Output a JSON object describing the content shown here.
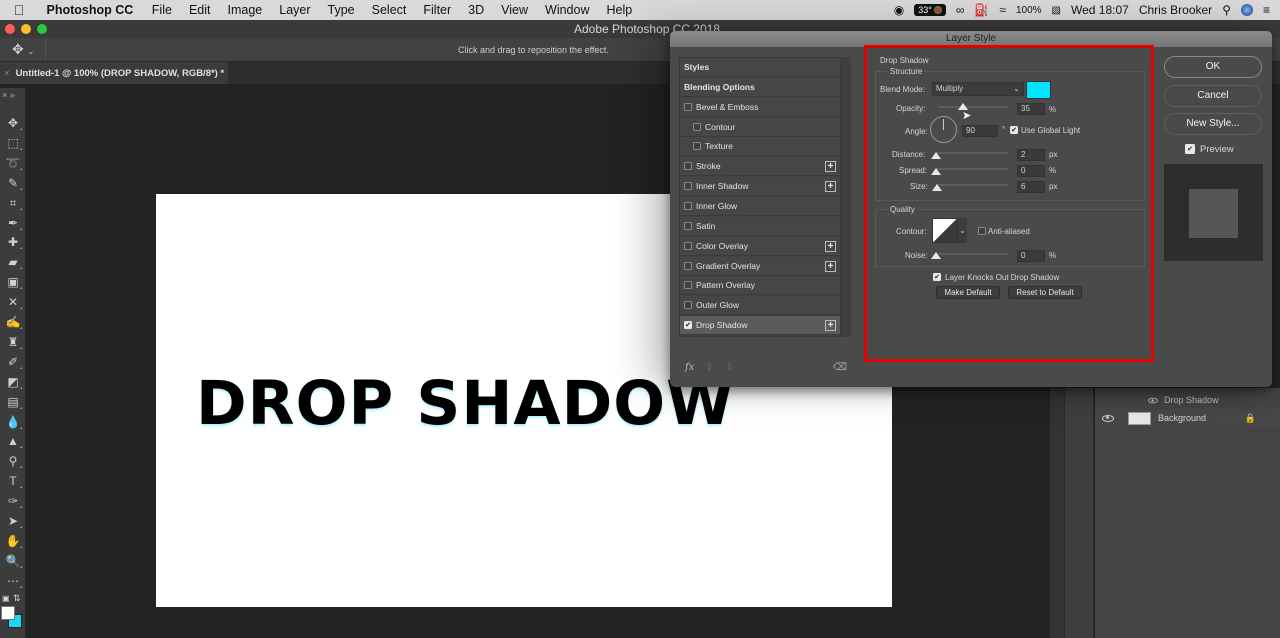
{
  "menubar": {
    "apple_icon": "apple-logo-icon",
    "items": [
      "Photoshop CC",
      "File",
      "Edit",
      "Image",
      "Layer",
      "Type",
      "Select",
      "Filter",
      "3D",
      "View",
      "Window",
      "Help"
    ],
    "status": {
      "temperature": "33°",
      "battery": "100%",
      "clock": "Wed 18:07",
      "user": "Chris Brooker"
    }
  },
  "window": {
    "title": "Adobe Photoshop CC 2018"
  },
  "options_bar": {
    "hint": "Click and drag to reposition the effect."
  },
  "document": {
    "tab_label": "Untitled-1 @ 100% (DROP SHADOW, RGB/8*) *",
    "canvas_text": "DROP SHADOW",
    "foreground_color": "#ffffff",
    "background_color": "#1ad6f7"
  },
  "toolbar": {
    "tools": [
      "move",
      "marquee",
      "lasso",
      "quick-select",
      "crop",
      "eyedropper",
      "healing",
      "brush-patch",
      "frame",
      "content-aware",
      "brush",
      "clone-stamp",
      "history-brush",
      "eraser",
      "gradient",
      "blur",
      "sharpen",
      "dodge",
      "type",
      "pen",
      "path-select",
      "hand",
      "zoom",
      "more"
    ]
  },
  "layers": {
    "effect_row": "Drop Shadow",
    "background_row": "Background"
  },
  "dialog": {
    "title": "Layer Style",
    "styles": [
      {
        "label": "Styles",
        "header": true
      },
      {
        "label": "Blending Options",
        "header": true
      },
      {
        "label": "Bevel & Emboss",
        "checked": false
      },
      {
        "label": "Contour",
        "checked": false,
        "indent": true
      },
      {
        "label": "Texture",
        "checked": false,
        "indent": true
      },
      {
        "label": "Stroke",
        "checked": false,
        "plus": true
      },
      {
        "label": "Inner Shadow",
        "checked": false,
        "plus": true
      },
      {
        "label": "Inner Glow",
        "checked": false
      },
      {
        "label": "Satin",
        "checked": false
      },
      {
        "label": "Color Overlay",
        "checked": false,
        "plus": true
      },
      {
        "label": "Gradient Overlay",
        "checked": false,
        "plus": true
      },
      {
        "label": "Pattern Overlay",
        "checked": false
      },
      {
        "label": "Outer Glow",
        "checked": false
      },
      {
        "label": "Drop Shadow",
        "checked": true,
        "plus": true,
        "selected": true
      }
    ],
    "footer": {
      "fx": "fx",
      "up": "▲",
      "down": "▼",
      "trash": "🗑"
    },
    "section_title": "Drop Shadow",
    "structure": {
      "title": "Structure",
      "blend_mode_label": "Blend Mode:",
      "blend_mode_value": "Multiply",
      "shadow_color": "#00e5ff",
      "opacity_label": "Opacity:",
      "opacity_value": "35",
      "opacity_unit": "%",
      "opacity_fraction": 0.35,
      "angle_label": "Angle:",
      "angle_value": "90",
      "angle_unit": "°",
      "use_global_light_label": "Use Global Light",
      "use_global_light": true,
      "distance_label": "Distance:",
      "distance_value": "2",
      "distance_unit": "px",
      "distance_fraction": 0.0,
      "spread_label": "Spread:",
      "spread_value": "0",
      "spread_unit": "%",
      "spread_fraction": 0.0,
      "size_label": "Size:",
      "size_value": "6",
      "size_unit": "px",
      "size_fraction": 0.02
    },
    "quality": {
      "title": "Quality",
      "contour_label": "Contour:",
      "anti_aliased_label": "Anti-aliased",
      "anti_aliased": false,
      "noise_label": "Noise:",
      "noise_value": "0",
      "noise_unit": "%",
      "noise_fraction": 0.0
    },
    "knockout_label": "Layer Knocks Out Drop Shadow",
    "knockout": true,
    "make_default": "Make Default",
    "reset_default": "Reset to Default",
    "ok": "OK",
    "cancel": "Cancel",
    "new_style": "New Style...",
    "preview_label": "Preview",
    "preview": true
  }
}
